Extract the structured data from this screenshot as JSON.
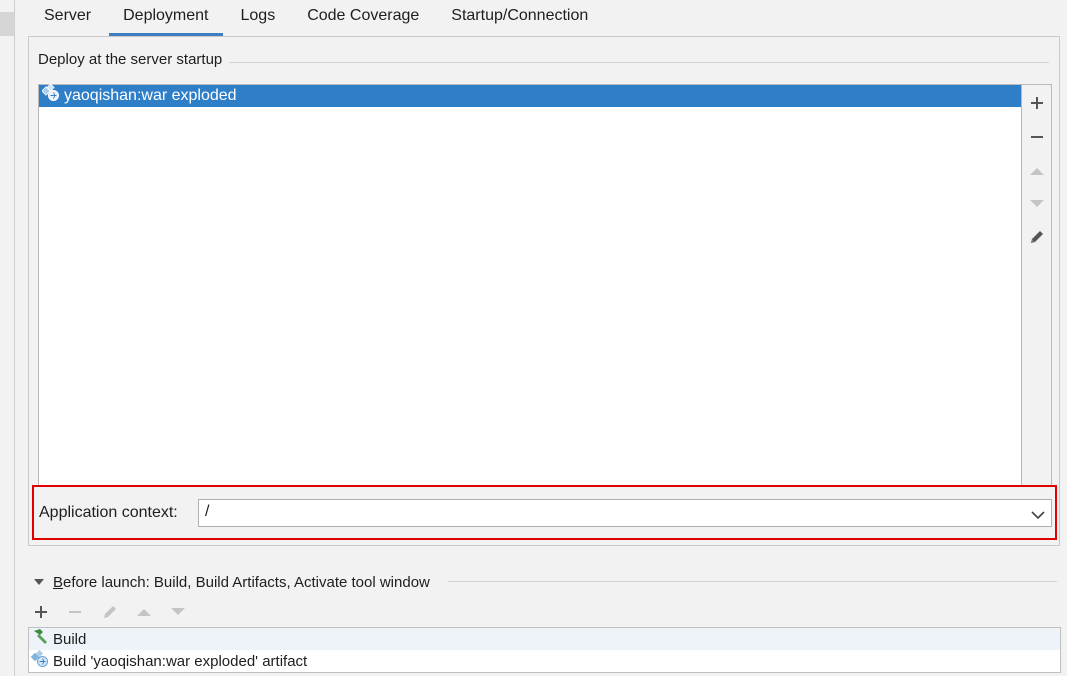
{
  "tabs": [
    {
      "label": "Server",
      "active": false
    },
    {
      "label": "Deployment",
      "active": true
    },
    {
      "label": "Logs",
      "active": false
    },
    {
      "label": "Code Coverage",
      "active": false
    },
    {
      "label": "Startup/Connection",
      "active": false
    }
  ],
  "deploy": {
    "group_title": "Deploy at the server startup",
    "items": [
      {
        "label": "yaoqishan:war exploded",
        "icon": "artifact-icon",
        "selected": true
      }
    ],
    "toolbar": [
      "add-icon",
      "remove-icon",
      "move-up-icon",
      "move-down-icon",
      "edit-icon"
    ]
  },
  "context": {
    "label": "Application context:",
    "value": "/"
  },
  "before_launch": {
    "title_prefix": "B",
    "title_rest": "efore launch: Build, Build Artifacts, Activate tool window",
    "toolbar": [
      "add-icon",
      "remove-icon",
      "edit-icon",
      "move-up-icon",
      "move-down-icon"
    ],
    "items": [
      {
        "label": "Build",
        "icon": "hammer-icon"
      },
      {
        "label": "Build 'yaoqishan:war exploded' artifact",
        "icon": "artifact-icon"
      }
    ]
  },
  "colors": {
    "accent": "#2f7ec8",
    "tab_underline": "#3d7ec0",
    "highlight_frame": "#e00000"
  }
}
